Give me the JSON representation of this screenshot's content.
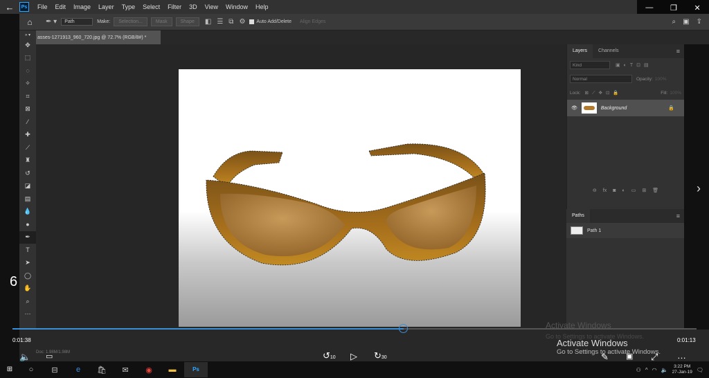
{
  "menubar": {
    "back_icon": "←",
    "app_icon_label": "Ps",
    "items": [
      "File",
      "Edit",
      "Image",
      "Layer",
      "Type",
      "Select",
      "Filter",
      "3D",
      "View",
      "Window",
      "Help"
    ]
  },
  "window_controls": {
    "minimize": "—",
    "restore": "❐",
    "close": "✕"
  },
  "options_bar": {
    "path_mode": "Path",
    "make_label": "Make:",
    "selection_btn": "Selection...",
    "mask_btn": "Mask",
    "shape_btn": "Shape",
    "auto_add_label": "Auto Add/Delete",
    "align_edges_label": "Align Edges"
  },
  "document": {
    "tab_title": "asses-1271913_960_720.jpg @ 72.7% (RGB/8#) *"
  },
  "layers_panel": {
    "tabs": [
      "Layers",
      "Channels"
    ],
    "kind_placeholder": "Kind",
    "blend_mode": "Normal",
    "opacity_label": "Opacity:",
    "opacity_value": "100%",
    "lock_label": "Lock:",
    "fill_label": "Fill:",
    "fill_value": "100%",
    "layers": [
      {
        "name": "Background"
      }
    ]
  },
  "paths_panel": {
    "tab": "Paths",
    "paths": [
      {
        "name": "Path 1"
      }
    ]
  },
  "player": {
    "left_number": "6",
    "current_time": "0:01:38",
    "remaining_time": "0:01:13",
    "progress": 0.572,
    "rewind_label": "10",
    "forward_label": "30"
  },
  "status_bar": {
    "doc_size": "Doc: 1.98M/1.98M"
  },
  "watermark": {
    "title": "Activate Windows",
    "subtitle": "Go to Settings to activate Windows."
  },
  "taskbar": {
    "time": "3:22 PM",
    "date": "27-Jan-19",
    "ps_label": "Ps"
  },
  "colors": {
    "accent": "#3a8fd8",
    "ps_blue": "#31a8ff"
  }
}
